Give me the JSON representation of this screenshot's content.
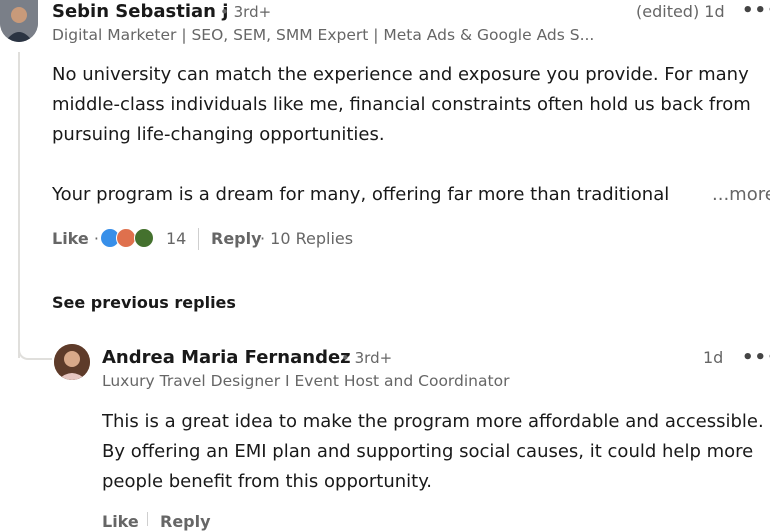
{
  "comment1": {
    "author": "Sebin Sebastian j",
    "degree": "• 3rd+",
    "headline": "Digital Marketer | SEO, SEM, SMM Expert | Meta Ads & Google Ads S...",
    "time": "(edited) 1d",
    "menu": "•••",
    "text_lines": [
      "No university can match the experience and exposure you provide. For many",
      "middle-class individuals like me, financial constraints often hold us back from",
      "pursuing life-changing opportunities.",
      "Your program is a dream for many, offering far more than traditional"
    ],
    "more": "...more",
    "like": "Like",
    "separator": "·",
    "reaction_count": "14",
    "reply": "Reply",
    "replies": "· 10 Replies",
    "reactions": [
      "like-icon",
      "love-icon",
      "support-icon"
    ],
    "colors": {
      "like": "#378fe9",
      "love": "#df704d",
      "support": "#44712e"
    }
  },
  "see_previous": "See previous replies",
  "comment2": {
    "author": "Andrea Maria Fernandez",
    "degree": "• 3rd+",
    "headline": "Luxury Travel Designer I Event Host and Coordinator",
    "time": "1d",
    "menu": "•••",
    "text_lines": [
      "This is a great idea to make the program more affordable and accessible.",
      "By offering an EMI plan and supporting social causes, it could help more",
      "people benefit from this opportunity."
    ],
    "like": "Like",
    "reply": "Reply"
  }
}
